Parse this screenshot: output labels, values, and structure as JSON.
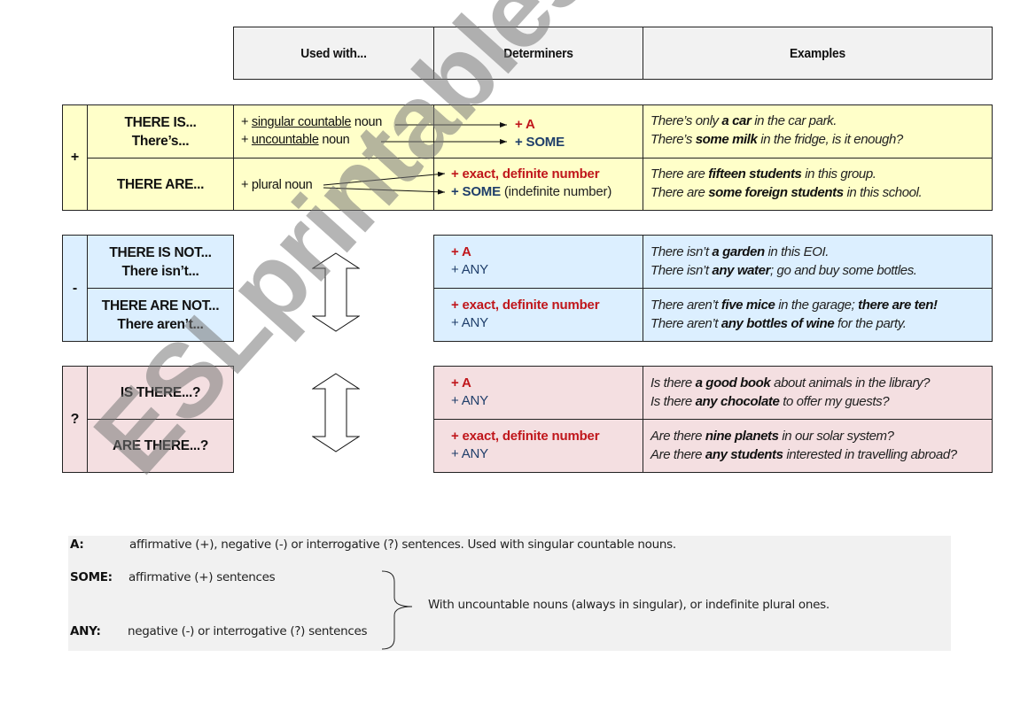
{
  "header": {
    "used_with": "Used with...",
    "determiners": "Determiners",
    "examples": "Examples"
  },
  "affirmative": {
    "symbol": "+",
    "rows": [
      {
        "form_line1": "THERE IS...",
        "form_line2": "There’s...",
        "used_with": [
          {
            "prefix": "+ ",
            "underlined": "singular countable",
            "suffix": " noun"
          },
          {
            "prefix": "+ ",
            "underlined": "uncountable",
            "suffix": " noun"
          }
        ],
        "determiners": [
          {
            "text": "+ A",
            "color": "red"
          },
          {
            "text": "+ SOME",
            "color": "navy"
          }
        ],
        "examples": [
          {
            "pre": "There’s only ",
            "bold": "a car",
            "post": " in the car park."
          },
          {
            "pre": "There’s ",
            "bold": "some milk",
            "post": " in the fridge, is it enough?"
          }
        ]
      },
      {
        "form_line1": "THERE ARE...",
        "used_with": [
          {
            "prefix": "+ ",
            "text": "plural noun"
          }
        ],
        "determiners": [
          {
            "text": "+ exact, definite number",
            "color": "red"
          },
          {
            "text": "+ SOME",
            "color": "navy",
            "note": " (indefinite number)"
          }
        ],
        "examples": [
          {
            "pre": "There are ",
            "bold": "fifteen students",
            "post": " in this group."
          },
          {
            "pre": "There are ",
            "bold": "some foreign students",
            "post": " in this school."
          }
        ]
      }
    ]
  },
  "negative": {
    "symbol": "-",
    "rows": [
      {
        "form_line1": "THERE IS NOT...",
        "form_line2": "There isn’t...",
        "determiners": [
          {
            "text": "+ A",
            "color": "red"
          },
          {
            "text": "+ ANY",
            "color": "navy"
          }
        ],
        "examples": [
          {
            "pre": "There isn’t ",
            "bold": "a garden",
            "post": " in this EOI."
          },
          {
            "pre": "There isn’t ",
            "bold": "any water",
            "post": "; go and buy some bottles."
          }
        ]
      },
      {
        "form_line1": "THERE ARE NOT...",
        "form_line2": "There aren’t...",
        "determiners": [
          {
            "text": "+ exact, definite number",
            "color": "red"
          },
          {
            "text": "+ ANY",
            "color": "navy"
          }
        ],
        "examples": [
          {
            "pre": "There aren’t ",
            "bold": "five mice",
            "post": " in the garage; ",
            "bold2": "there are ten!"
          },
          {
            "pre": "There aren’t ",
            "bold": "any bottles of wine",
            "post": " for the party."
          }
        ]
      }
    ]
  },
  "interrogative": {
    "symbol": "?",
    "rows": [
      {
        "form_line1": "IS THERE...?",
        "determiners": [
          {
            "text": "+ A",
            "color": "red"
          },
          {
            "text": "+ ANY",
            "color": "navy"
          }
        ],
        "examples": [
          {
            "pre": "Is there ",
            "bold": "a good book",
            "post": " about animals in the library?"
          },
          {
            "pre": "Is there ",
            "bold": "any chocolate",
            "post": " to offer my guests?"
          }
        ]
      },
      {
        "form_line1": "ARE THERE...?",
        "determiners": [
          {
            "text": "+ exact, definite number",
            "color": "red"
          },
          {
            "text": "+ ANY",
            "color": "navy"
          }
        ],
        "examples": [
          {
            "pre": "Are there ",
            "bold": "nine planets",
            "post": " in our solar system?"
          },
          {
            "pre": "Are there ",
            "bold": "any students",
            "post": " interested in travelling abroad?"
          }
        ]
      }
    ]
  },
  "notes": {
    "a_label": "A:",
    "a_text": "affirmative (+), negative (-) or interrogative (?) sentences. Used with singular countable nouns.",
    "some_label": "SOME:",
    "some_text": "affirmative (+) sentences",
    "any_label": "ANY:",
    "any_text": "negative (-) or interrogative (?) sentences",
    "shared_text": "With uncountable nouns (always in singular), or indefinite plural ones."
  },
  "colors": {
    "red": "#c0161b",
    "navy": "#1f3e6a",
    "affirmative_bg": "#ffffc9",
    "negative_bg": "#dcefff",
    "interrogative_bg": "#f4dfe1",
    "header_bg": "#f2f2f2"
  },
  "watermark": "ESLprintables.com"
}
